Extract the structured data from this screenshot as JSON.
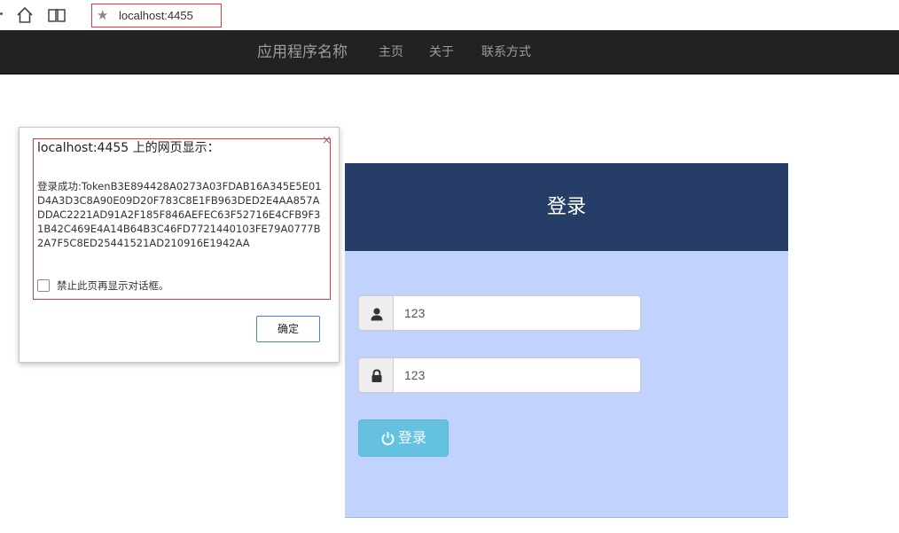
{
  "browser": {
    "url": "localhost:4455",
    "icons": [
      "home-icon",
      "reader-icon",
      "star-icon"
    ]
  },
  "navbar": {
    "brand": "应用程序名称",
    "links": [
      "主页",
      "关于",
      "联系方式"
    ]
  },
  "login": {
    "title": "登录",
    "username_value": "123",
    "password_value": "123",
    "submit_label": "登录",
    "colors": {
      "header_bg": "#263d68",
      "panel_bg": "#c1d3fc",
      "button_bg": "#5bc0de"
    }
  },
  "dialog": {
    "title": "localhost:4455 上的网页显示：",
    "message": "登录成功:TokenB3E894428A0273A03FDAB16A345E5E01D4A3D3C8A90E09D20F783C8E1FB963DED2E4AA857ADDAC2221AD91A2F185F846AEFEC63F52716E4CFB9F31B42C469E4A14B64B3C46FD7721440103FE79A0777B2A7F5C8ED25441521AD210916E1942AA",
    "checkbox_label": "禁止此页再显示对话框。",
    "ok_label": "确定",
    "close_symbol": "×"
  }
}
